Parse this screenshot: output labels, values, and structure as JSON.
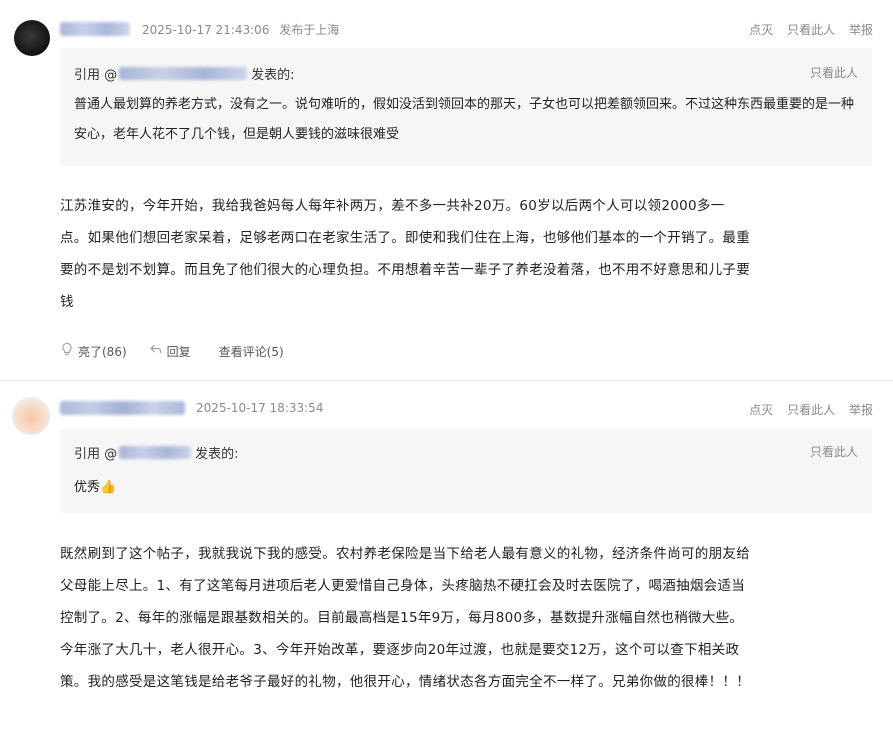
{
  "post1": {
    "timestamp": "2025-10-17 21:43:06",
    "location": "发布于上海",
    "actions": [
      "点灭",
      "只看此人",
      "举报"
    ],
    "quote": {
      "prefix": "引用 @",
      "suffix": "发表的:",
      "only_this": "只看此人",
      "body": "普通人最划算的养老方式，没有之一。说句难听的，假如没活到领回本的那天，子女也可以把差额领回来。不过这种东西最重要的是一种安心，老年人花不了几个钱，但是朝人要钱的滋味很难受"
    },
    "content": "江苏淮安的，今年开始，我给我爸妈每人每年补两万，差不多一共补20万。60岁以后两个人可以领2000多一点。如果他们想回老家呆着，足够老两口在老家生活了。即使和我们住在上海，也够他们基本的一个开销了。最重要的不是划不划算。而且免了他们很大的心理负担。不用想着辛苦一辈子了养老没着落，也不用不好意思和儿子要钱",
    "footer": {
      "like": "亮了(86)",
      "reply": "回复",
      "view_comments": "查看评论(5)"
    }
  },
  "post2": {
    "timestamp": "2025-10-17 18:33:54",
    "actions": [
      "点灭",
      "只看此人",
      "举报"
    ],
    "quote": {
      "prefix": "引用 @",
      "suffix": "发表的:",
      "only_this": "只看此人",
      "body": "优秀👍"
    },
    "content": "既然刷到了这个帖子，我就我说下我的感受。农村养老保险是当下给老人最有意义的礼物，经济条件尚可的朋友给父母能上尽上。1、有了这笔每月进项后老人更爱惜自己身体，头疼脑热不硬扛会及时去医院了，喝酒抽烟会适当控制了。2、每年的涨幅是跟基数相关的。目前最高档是15年9万，每月800多，基数提升涨幅自然也稍微大些。今年涨了大几十，老人很开心。3、今年开始改革，要逐步向20年过渡，也就是要交12万，这个可以查下相关政策。我的感受是这笔钱是给老爷子最好的礼物，他很开心，情绪状态各方面完全不一样了。兄弟你做的很棒！！！"
  }
}
